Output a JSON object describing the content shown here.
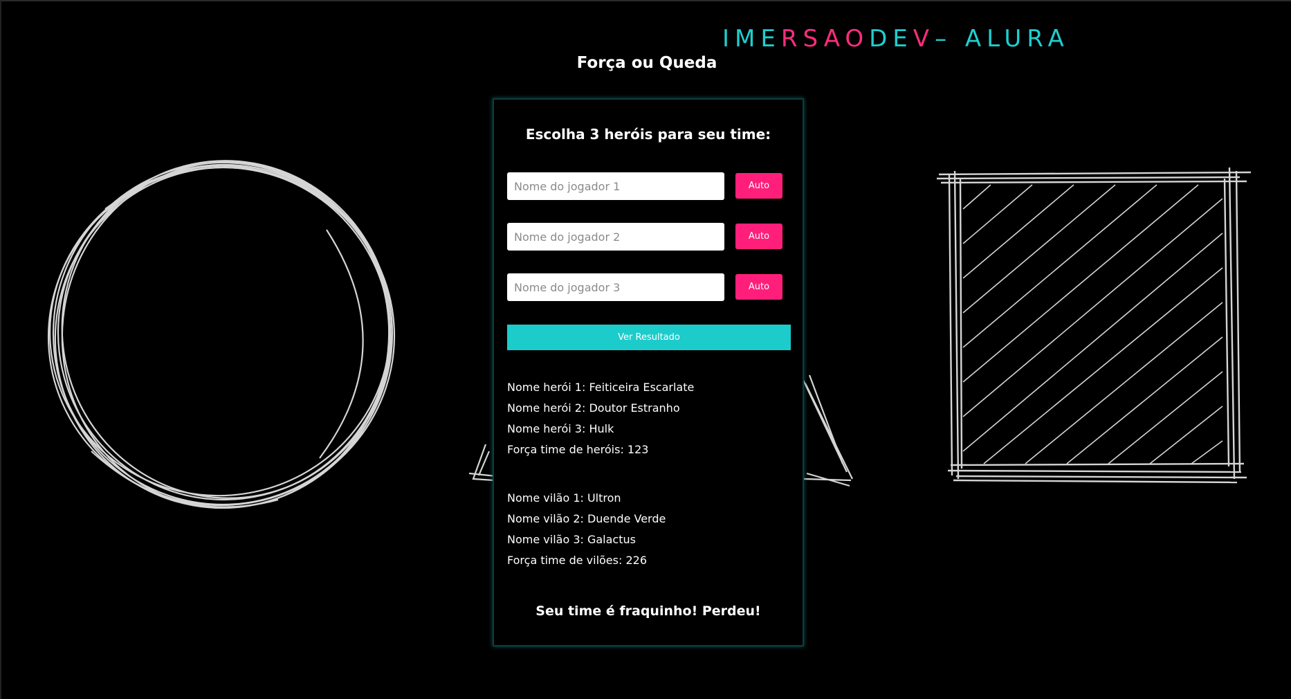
{
  "logo": {
    "part1": "IME",
    "part2": "RSAO",
    "part3": " DE",
    "part4": "V",
    "part5": " – ALURA"
  },
  "page": {
    "title": "Força ou Queda"
  },
  "card": {
    "title": "Escolha 3 heróis para seu time:",
    "players": [
      {
        "placeholder": "Nome do jogador 1",
        "value": "",
        "button": "Auto"
      },
      {
        "placeholder": "Nome do jogador 2",
        "value": "",
        "button": "Auto"
      },
      {
        "placeholder": "Nome do jogador 3",
        "value": "",
        "button": "Auto"
      }
    ],
    "result_button": "Ver Resultado",
    "heroes": [
      "Nome herói 1: Feiticeira Escarlate",
      "Nome herói 2: Doutor Estranho",
      "Nome herói 3: Hulk",
      "Força time de heróis: 123"
    ],
    "villains": [
      "Nome vilão 1: Ultron",
      "Nome vilão 2: Duende Verde",
      "Nome vilão 3: Galactus",
      "Força time de vilões: 226"
    ],
    "verdict": "Seu time é fraquinho! Perdeu!"
  },
  "colors": {
    "background": "#000000",
    "accent_cyan": "#1ccccb",
    "accent_pink": "#ff1f7b"
  },
  "icons": {
    "left": "sketch-circle-icon",
    "middle": "sketch-triangle-icon",
    "right": "sketch-square-icon"
  }
}
